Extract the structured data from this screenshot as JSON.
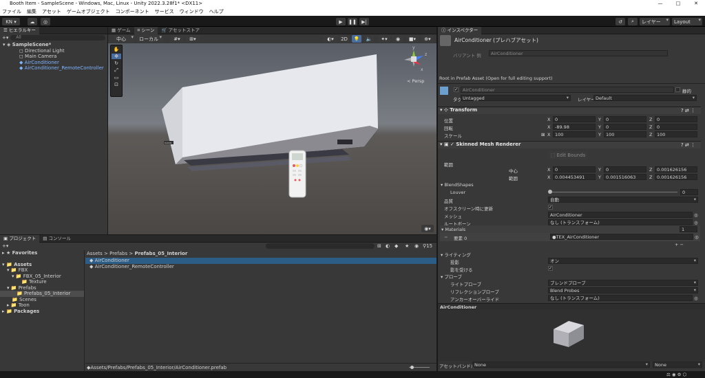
{
  "window": {
    "title": "Booth Item - SampleScene - Windows, Mac, Linux - Unity 2022.3.28f1* <DX11>",
    "min": "—",
    "max": "□",
    "close": "✕"
  },
  "menu": [
    "ファイル",
    "編集",
    "アセット",
    "ゲームオブジェクト",
    "コンポーネント",
    "サービス",
    "ウィンドウ",
    "ヘルプ"
  ],
  "toolbar": {
    "account": "KN ▾",
    "layers": "レイヤー",
    "layout": "Layout"
  },
  "hierarchy": {
    "tab": "ヒエラルキー",
    "search": "All",
    "scene": "SampleScene*",
    "items": [
      "Directional Light",
      "Main Camera",
      "AirConditioner",
      "AirConditioner_RemoteController"
    ]
  },
  "scene_tabs": [
    "ゲーム",
    "シーン",
    "アセットストア"
  ],
  "scene": {
    "pivot": "中心",
    "space": "ローカル",
    "mode2d": "2D",
    "persp": "< Persp",
    "axes": {
      "y": "y",
      "x": "x",
      "z": "z"
    },
    "brand": "DAIKIN"
  },
  "project": {
    "tabs": [
      "プロジェクト",
      "コンソール"
    ],
    "count": "15",
    "favorites": "Favorites",
    "tree": [
      "Assets",
      "FBX",
      "FBX_05_Interior",
      "Texture",
      "Prefabs",
      "Prefabs_05_Interior",
      "Scenes",
      "Toon",
      "Packages"
    ],
    "breadcrumb": [
      "Assets",
      ">",
      "Prefabs",
      ">",
      "Prefabs_05_Interior"
    ],
    "files": [
      "AirConditioner",
      "AirConditioner_RemoteController"
    ],
    "path": "Assets/Prefabs/Prefabs_05_Interior/AirConditioner.prefab"
  },
  "inspector": {
    "tab": "インスペクター",
    "name": "AirConditioner (プレハブアセット)",
    "variant_label": "バリアント 例",
    "variant_value": "AirConditioner",
    "root_note": "Root in Prefab Asset (Open for full editing support)",
    "obj_name": "AirConditioner",
    "static": "静的",
    "tag_label": "タグ",
    "tag": "Untagged",
    "layer_label": "レイヤー",
    "layer": "Default",
    "transform": {
      "title": "Transform",
      "pos": "位置",
      "rot": "回転",
      "scale": "スケール",
      "px": "0",
      "py": "0",
      "pz": "0",
      "rx": "-89.98",
      "ry": "0",
      "rz": "0",
      "sx": "100",
      "sy": "100",
      "sz": "100"
    },
    "smr": {
      "title": "Skinned Mesh Renderer",
      "edit_bounds": "Edit Bounds",
      "bounds": "範囲",
      "center": "中心",
      "extent": "範囲",
      "cx": "0",
      "cy": "0",
      "cz": "0.001626156",
      "ex": "0.004453491",
      "ey": "0.001516063",
      "ez": "0.001626156",
      "blendshapes": "BlendShapes",
      "louver": "Louver",
      "louver_val": "0",
      "quality": "品質",
      "quality_val": "自動",
      "offscreen": "オフスクリーン時に更新",
      "mesh": "メッシュ",
      "mesh_val": "AirConditioner",
      "rootbone": "ルートボーン",
      "rootbone_val": "なし (トランスフォーム)",
      "materials": "Materials",
      "mat_count": "1",
      "elem": "要素 0",
      "mat_val": "TEX_AirConditioner",
      "lighting": "ライティング",
      "cast": "投影",
      "cast_val": "オン",
      "receive": "影を受ける",
      "probes": "プローブ",
      "lightprobe": "ライトプローブ",
      "lightprobe_val": "ブレンドプローブ",
      "reflprobe": "リフレクションプローブ",
      "reflprobe_val": "Blend Probes",
      "anchor": "アンカーオーバーライド",
      "anchor_val": "なし (トランスフォーム)"
    },
    "preview_title": "AirConditioner",
    "bundle_label": "アセットバンドル",
    "bundle_val": "None",
    "bundle_val2": "None"
  }
}
